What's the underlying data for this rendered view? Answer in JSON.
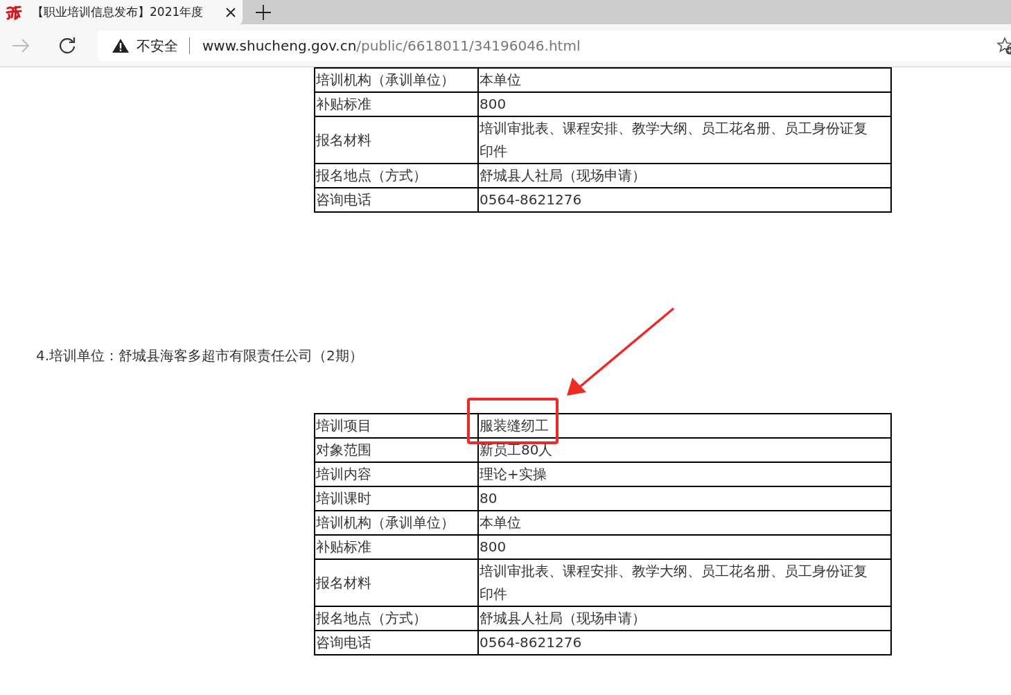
{
  "browser": {
    "tab": {
      "title": "【职业培训信息发布】2021年度",
      "selected": true
    },
    "back_disabled": true,
    "security_label": "不安全",
    "url_host": "www.shucheng.gov.cn",
    "url_path": "/public/6618011/34196046.html"
  },
  "sections": [
    {
      "table": {
        "rows": [
          {
            "label": "培训机构（承训单位）",
            "value": "本单位"
          },
          {
            "label": "补贴标准",
            "value": "800"
          },
          {
            "label": "报名材料",
            "value": "培训审批表、课程安排、教学大纲、员工花名册、员工身份证复印件"
          },
          {
            "label": "报名地点（方式）",
            "value": "舒城县人社局（现场申请）"
          },
          {
            "label": "咨询电话",
            "value": "0564-8621276"
          }
        ]
      }
    },
    {
      "heading": "4.培训单位：舒城县海客多超市有限责任公司（2期）",
      "table": {
        "rows": [
          {
            "label": "培训项目",
            "value": "服装缝纫工",
            "highlighted": true
          },
          {
            "label": "对象范围",
            "value": "新员工80人"
          },
          {
            "label": "培训内容",
            "value": "理论+实操"
          },
          {
            "label": "培训课时",
            "value": "80"
          },
          {
            "label": "培训机构（承训单位）",
            "value": "本单位"
          },
          {
            "label": "补贴标准",
            "value": "800"
          },
          {
            "label": "报名材料",
            "value": "培训审批表、课程安排、教学大纲、员工花名册、员工身份证复印件"
          },
          {
            "label": "报名地点（方式）",
            "value": "舒城县人社局（现场申请）"
          },
          {
            "label": "咨询电话",
            "value": "0564-8621276"
          }
        ]
      }
    }
  ]
}
